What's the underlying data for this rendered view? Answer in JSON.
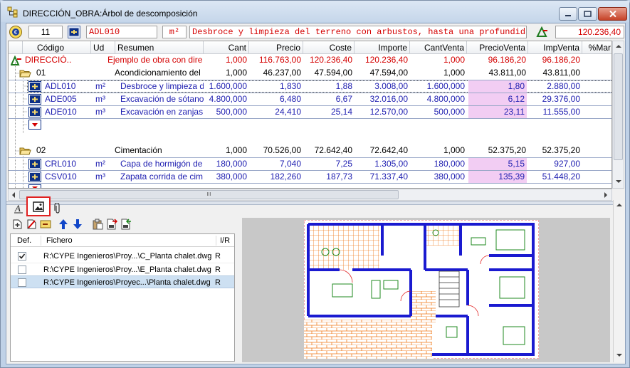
{
  "window": {
    "title": "DIRECCIÓN_OBRA:Árbol de descomposición"
  },
  "topbar": {
    "level": "11",
    "code": "ADL010",
    "unit": "m²",
    "summary": "Desbroce y limpieza del terreno con arbustos, hasta una profundidad",
    "total": "120.236,40"
  },
  "grid": {
    "columns": [
      "Código",
      "Ud",
      "Resumen",
      "Cant",
      "Precio",
      "Coste",
      "Importe",
      "CantVenta",
      "PrecioVenta",
      "ImpVenta",
      "%Mar"
    ],
    "rows": [
      {
        "code": "DIRECCIÓ..",
        "ud": "",
        "resumen": "Ejemplo de obra con dire",
        "cant": "1,000",
        "precio": "116.763,00",
        "coste": "120.236,40",
        "importe": "120.236,40",
        "cantventa": "1,000",
        "precioventa": "96.186,20",
        "impventa": "96.186,20"
      },
      {
        "code": "01",
        "ud": "",
        "resumen": "Acondicionamiento del",
        "cant": "1,000",
        "precio": "46.237,00",
        "coste": "47.594,00",
        "importe": "47.594,00",
        "cantventa": "1,000",
        "precioventa": "43.811,00",
        "impventa": "43.811,00"
      },
      {
        "code": "ADL010",
        "ud": "m²",
        "resumen": "Desbroce y limpieza d",
        "cant": "1.600,000",
        "precio": "1,830",
        "coste": "1,88",
        "importe": "3.008,00",
        "cantventa": "1.600,000",
        "precioventa": "1,80",
        "impventa": "2.880,00"
      },
      {
        "code": "ADE005",
        "ud": "m³",
        "resumen": "Excavación de sótano",
        "cant": "4.800,000",
        "precio": "6,480",
        "coste": "6,67",
        "importe": "32.016,00",
        "cantventa": "4.800,000",
        "precioventa": "6,12",
        "impventa": "29.376,00"
      },
      {
        "code": "ADE010",
        "ud": "m³",
        "resumen": "Excavación en zanjas",
        "cant": "500,000",
        "precio": "24,410",
        "coste": "25,14",
        "importe": "12.570,00",
        "cantventa": "500,000",
        "precioventa": "23,11",
        "impventa": "11.555,00"
      },
      {
        "code": "02",
        "ud": "",
        "resumen": "Cimentación",
        "cant": "1,000",
        "precio": "70.526,00",
        "coste": "72.642,40",
        "importe": "72.642,40",
        "cantventa": "1,000",
        "precioventa": "52.375,20",
        "impventa": "52.375,20"
      },
      {
        "code": "CRL010",
        "ud": "m²",
        "resumen": "Capa de hormigón de",
        "cant": "180,000",
        "precio": "7,040",
        "coste": "7,25",
        "importe": "1.305,00",
        "cantventa": "180,000",
        "precioventa": "5,15",
        "impventa": "927,00"
      },
      {
        "code": "CSV010",
        "ud": "m³",
        "resumen": "Zapata corrida de cim",
        "cant": "380,000",
        "precio": "182,260",
        "coste": "187,73",
        "importe": "71.337,40",
        "cantventa": "380,000",
        "precioventa": "135,39",
        "impventa": "51.448,20"
      }
    ],
    "scroll_glyph": "III"
  },
  "files": {
    "columns": [
      "Def.",
      "Fichero",
      "I/R"
    ],
    "rows": [
      {
        "checked": true,
        "path": "R:\\CYPE Ingenieros\\Proy...\\C_Planta chalet.dwg",
        "ir": "R"
      },
      {
        "checked": false,
        "path": "R:\\CYPE Ingenieros\\Proy...\\E_Planta chalet.dwg",
        "ir": "R"
      },
      {
        "checked": false,
        "path": "R:\\CYPE Ingenieros\\Proyec...\\Planta chalet.dwg",
        "ir": "R"
      }
    ]
  },
  "colors": {
    "red": "#d40000",
    "blue": "#1d1db0",
    "price_highlight": "#f2cdf3",
    "selected_row": "#cde0f2"
  }
}
